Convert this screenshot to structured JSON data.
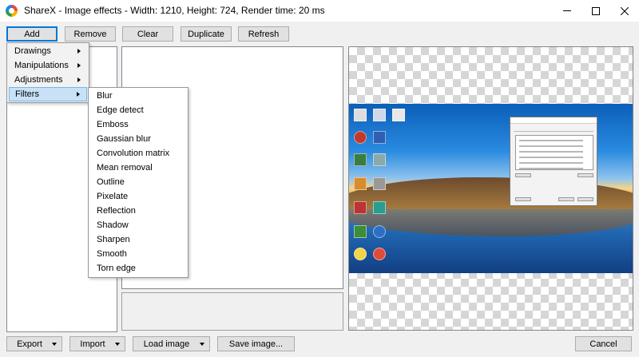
{
  "window": {
    "title": "ShareX - Image effects - Width: 1210, Height: 724, Render time: 20 ms",
    "minimize_icon": "minimize-icon",
    "maximize_icon": "maximize-icon",
    "close_icon": "close-icon"
  },
  "toolbar": {
    "add_label": "Add",
    "remove_label": "Remove",
    "clear_label": "Clear",
    "duplicate_label": "Duplicate",
    "refresh_label": "Refresh"
  },
  "add_menu": {
    "items": [
      {
        "label": "Drawings"
      },
      {
        "label": "Manipulations"
      },
      {
        "label": "Adjustments"
      },
      {
        "label": "Filters"
      }
    ],
    "selected": "Filters"
  },
  "filters_menu": {
    "items": [
      "Blur",
      "Edge detect",
      "Emboss",
      "Gaussian blur",
      "Convolution matrix",
      "Mean removal",
      "Outline",
      "Pixelate",
      "Reflection",
      "Shadow",
      "Sharpen",
      "Smooth",
      "Torn edge"
    ]
  },
  "bottom": {
    "export_label": "Export",
    "import_label": "Import",
    "load_image_label": "Load image",
    "save_image_label": "Save image...",
    "cancel_label": "Cancel"
  },
  "colors": {
    "menu_highlight": "#c8e1f7",
    "menu_highlight_border": "#78b7ea",
    "primary_border": "#0078d7"
  }
}
